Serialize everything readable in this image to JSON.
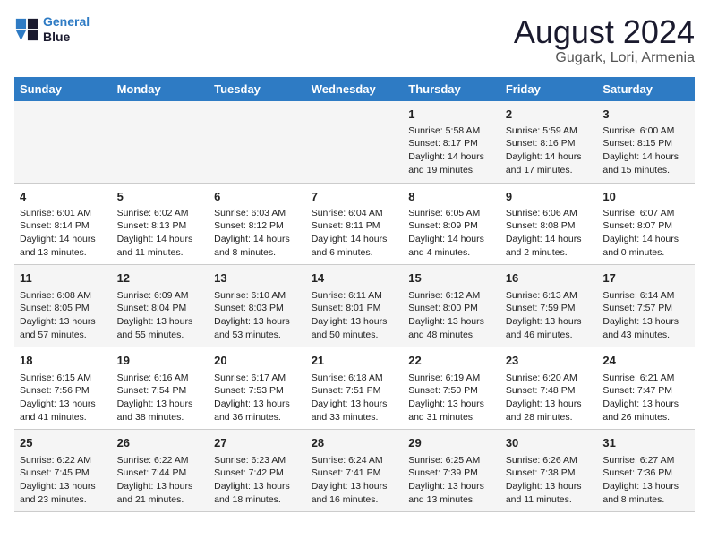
{
  "logo": {
    "line1": "General",
    "line2": "Blue"
  },
  "title": "August 2024",
  "subtitle": "Gugark, Lori, Armenia",
  "days_of_week": [
    "Sunday",
    "Monday",
    "Tuesday",
    "Wednesday",
    "Thursday",
    "Friday",
    "Saturday"
  ],
  "weeks": [
    [
      {
        "day": "",
        "content": ""
      },
      {
        "day": "",
        "content": ""
      },
      {
        "day": "",
        "content": ""
      },
      {
        "day": "",
        "content": ""
      },
      {
        "day": "1",
        "content": "Sunrise: 5:58 AM\nSunset: 8:17 PM\nDaylight: 14 hours\nand 19 minutes."
      },
      {
        "day": "2",
        "content": "Sunrise: 5:59 AM\nSunset: 8:16 PM\nDaylight: 14 hours\nand 17 minutes."
      },
      {
        "day": "3",
        "content": "Sunrise: 6:00 AM\nSunset: 8:15 PM\nDaylight: 14 hours\nand 15 minutes."
      }
    ],
    [
      {
        "day": "4",
        "content": "Sunrise: 6:01 AM\nSunset: 8:14 PM\nDaylight: 14 hours\nand 13 minutes."
      },
      {
        "day": "5",
        "content": "Sunrise: 6:02 AM\nSunset: 8:13 PM\nDaylight: 14 hours\nand 11 minutes."
      },
      {
        "day": "6",
        "content": "Sunrise: 6:03 AM\nSunset: 8:12 PM\nDaylight: 14 hours\nand 8 minutes."
      },
      {
        "day": "7",
        "content": "Sunrise: 6:04 AM\nSunset: 8:11 PM\nDaylight: 14 hours\nand 6 minutes."
      },
      {
        "day": "8",
        "content": "Sunrise: 6:05 AM\nSunset: 8:09 PM\nDaylight: 14 hours\nand 4 minutes."
      },
      {
        "day": "9",
        "content": "Sunrise: 6:06 AM\nSunset: 8:08 PM\nDaylight: 14 hours\nand 2 minutes."
      },
      {
        "day": "10",
        "content": "Sunrise: 6:07 AM\nSunset: 8:07 PM\nDaylight: 14 hours\nand 0 minutes."
      }
    ],
    [
      {
        "day": "11",
        "content": "Sunrise: 6:08 AM\nSunset: 8:05 PM\nDaylight: 13 hours\nand 57 minutes."
      },
      {
        "day": "12",
        "content": "Sunrise: 6:09 AM\nSunset: 8:04 PM\nDaylight: 13 hours\nand 55 minutes."
      },
      {
        "day": "13",
        "content": "Sunrise: 6:10 AM\nSunset: 8:03 PM\nDaylight: 13 hours\nand 53 minutes."
      },
      {
        "day": "14",
        "content": "Sunrise: 6:11 AM\nSunset: 8:01 PM\nDaylight: 13 hours\nand 50 minutes."
      },
      {
        "day": "15",
        "content": "Sunrise: 6:12 AM\nSunset: 8:00 PM\nDaylight: 13 hours\nand 48 minutes."
      },
      {
        "day": "16",
        "content": "Sunrise: 6:13 AM\nSunset: 7:59 PM\nDaylight: 13 hours\nand 46 minutes."
      },
      {
        "day": "17",
        "content": "Sunrise: 6:14 AM\nSunset: 7:57 PM\nDaylight: 13 hours\nand 43 minutes."
      }
    ],
    [
      {
        "day": "18",
        "content": "Sunrise: 6:15 AM\nSunset: 7:56 PM\nDaylight: 13 hours\nand 41 minutes."
      },
      {
        "day": "19",
        "content": "Sunrise: 6:16 AM\nSunset: 7:54 PM\nDaylight: 13 hours\nand 38 minutes."
      },
      {
        "day": "20",
        "content": "Sunrise: 6:17 AM\nSunset: 7:53 PM\nDaylight: 13 hours\nand 36 minutes."
      },
      {
        "day": "21",
        "content": "Sunrise: 6:18 AM\nSunset: 7:51 PM\nDaylight: 13 hours\nand 33 minutes."
      },
      {
        "day": "22",
        "content": "Sunrise: 6:19 AM\nSunset: 7:50 PM\nDaylight: 13 hours\nand 31 minutes."
      },
      {
        "day": "23",
        "content": "Sunrise: 6:20 AM\nSunset: 7:48 PM\nDaylight: 13 hours\nand 28 minutes."
      },
      {
        "day": "24",
        "content": "Sunrise: 6:21 AM\nSunset: 7:47 PM\nDaylight: 13 hours\nand 26 minutes."
      }
    ],
    [
      {
        "day": "25",
        "content": "Sunrise: 6:22 AM\nSunset: 7:45 PM\nDaylight: 13 hours\nand 23 minutes."
      },
      {
        "day": "26",
        "content": "Sunrise: 6:22 AM\nSunset: 7:44 PM\nDaylight: 13 hours\nand 21 minutes."
      },
      {
        "day": "27",
        "content": "Sunrise: 6:23 AM\nSunset: 7:42 PM\nDaylight: 13 hours\nand 18 minutes."
      },
      {
        "day": "28",
        "content": "Sunrise: 6:24 AM\nSunset: 7:41 PM\nDaylight: 13 hours\nand 16 minutes."
      },
      {
        "day": "29",
        "content": "Sunrise: 6:25 AM\nSunset: 7:39 PM\nDaylight: 13 hours\nand 13 minutes."
      },
      {
        "day": "30",
        "content": "Sunrise: 6:26 AM\nSunset: 7:38 PM\nDaylight: 13 hours\nand 11 minutes."
      },
      {
        "day": "31",
        "content": "Sunrise: 6:27 AM\nSunset: 7:36 PM\nDaylight: 13 hours\nand 8 minutes."
      }
    ]
  ]
}
